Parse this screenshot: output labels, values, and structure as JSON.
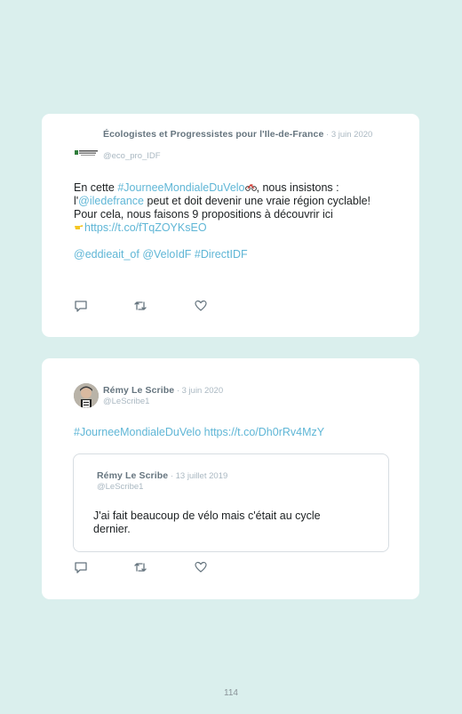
{
  "tweets": [
    {
      "author": "Écologistes et Progressistes pour l'Ile-de-France",
      "date": " · 3 juin 2020",
      "handle": "@eco_pro_IDF",
      "text_1": "En cette ",
      "hashtag_1": "#JourneeMondialeDuVelo",
      "text_2": ", nous insistons :",
      "text_3": "l'",
      "mention_1": "@iledefrance",
      "text_4": " peut et doit devenir une vraie région cyclable! Pour cela, nous faisons 9 propositions à découvrir ici",
      "url": "https://t.co/fTqZOYKsEO",
      "mentions_line": "@eddieait_of @VeloIdF #DirectIDF"
    },
    {
      "author": "Rémy Le Scribe",
      "date": " · 3 juin 2020",
      "handle": "@LeScribe1",
      "hashtag": "#JourneeMondialeDuVelo",
      "url": " https://t.co/Dh0rRv4MzY",
      "quoted": {
        "author": "Rémy Le Scribe",
        "date": " · 13 juillet 2019",
        "handle": "@LeScribe1",
        "text": "J'ai fait beaucoup de vélo mais c'était au cycle dernier."
      }
    }
  ],
  "icons": [
    "reply-icon",
    "retweet-icon",
    "like-icon",
    "bicycle-emoji-icon",
    "pointing-hand-icon"
  ],
  "colors": {
    "background": "#daefed",
    "link": "#5fb6d6",
    "muted": "#aab8c2"
  },
  "page_number": "114"
}
